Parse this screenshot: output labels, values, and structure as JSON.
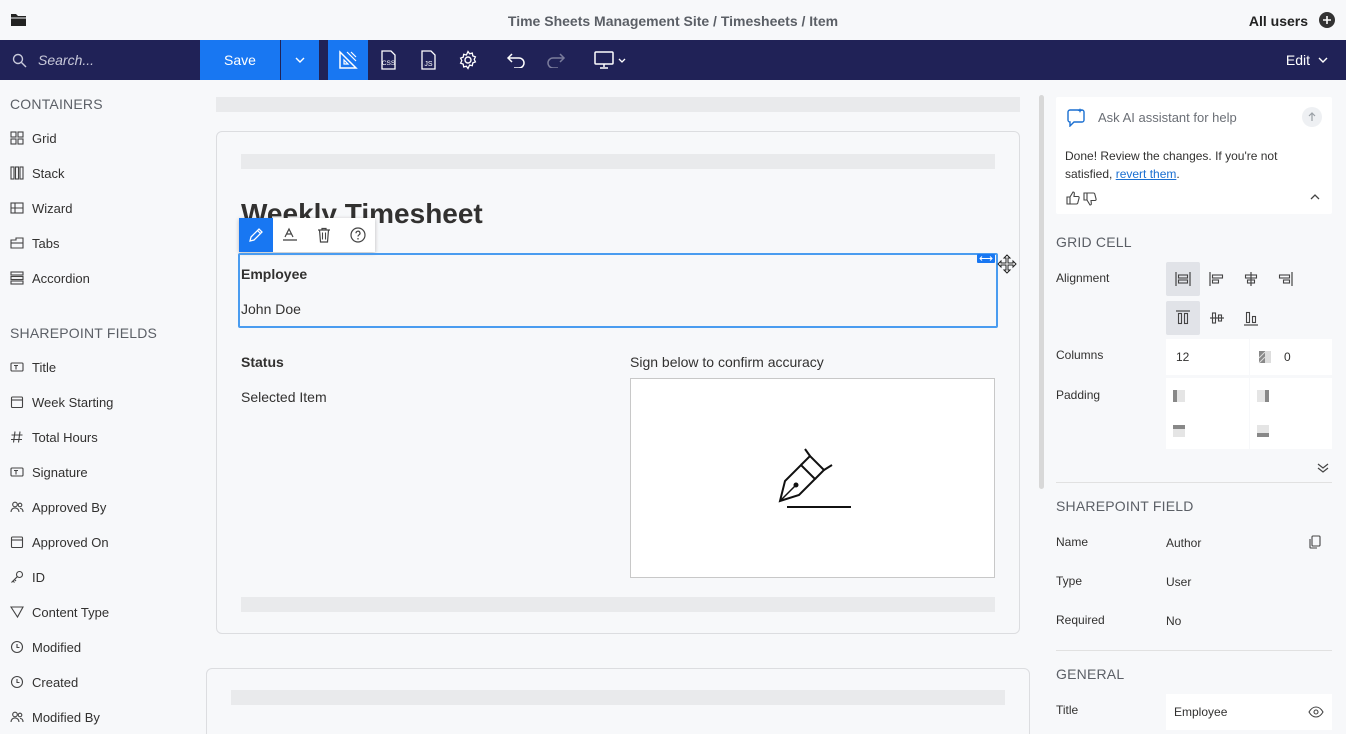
{
  "breadcrumb": "Time Sheets Management Site / Timesheets / Item",
  "users_label": "All users",
  "toolbar": {
    "search_placeholder": "Search...",
    "save_label": "Save",
    "css_label": "CSS",
    "js_label": "JS",
    "edit_label": "Edit"
  },
  "left": {
    "containers_title": "CONTAINERS",
    "containers": [
      {
        "label": "Grid",
        "icon": "grid-icon"
      },
      {
        "label": "Stack",
        "icon": "stack-icon"
      },
      {
        "label": "Wizard",
        "icon": "wizard-icon"
      },
      {
        "label": "Tabs",
        "icon": "tabs-icon"
      },
      {
        "label": "Accordion",
        "icon": "accordion-icon"
      }
    ],
    "fields_title": "SHAREPOINT FIELDS",
    "fields": [
      {
        "label": "Title",
        "icon": "text-field-icon"
      },
      {
        "label": "Week Starting",
        "icon": "calendar-icon"
      },
      {
        "label": "Total Hours",
        "icon": "number-icon"
      },
      {
        "label": "Signature",
        "icon": "text-field-icon"
      },
      {
        "label": "Approved By",
        "icon": "people-icon"
      },
      {
        "label": "Approved On",
        "icon": "calendar-icon"
      },
      {
        "label": "ID",
        "icon": "key-icon"
      },
      {
        "label": "Content Type",
        "icon": "filter-icon"
      },
      {
        "label": "Modified",
        "icon": "clock-icon"
      },
      {
        "label": "Created",
        "icon": "clock-icon"
      },
      {
        "label": "Modified By",
        "icon": "people-icon"
      }
    ]
  },
  "form": {
    "title": "Weekly Timesheet",
    "employee_label": "Employee",
    "employee_value": "John Doe",
    "status_label": "Status",
    "status_value": "Selected Item",
    "signature_label": "Sign below to confirm accuracy"
  },
  "ai": {
    "placeholder": "Ask AI assistant for help",
    "message": "Done! Review the changes. If you're not satisfied,",
    "link": "revert them",
    "message_end": "."
  },
  "grid_cell": {
    "title": "GRID CELL",
    "alignment_label": "Alignment",
    "columns_label": "Columns",
    "columns_value": "12",
    "offset_value": "0",
    "padding_label": "Padding"
  },
  "sp_field": {
    "title": "SHAREPOINT FIELD",
    "name_label": "Name",
    "name_value": "Author",
    "type_label": "Type",
    "type_value": "User",
    "required_label": "Required",
    "required_value": "No"
  },
  "general": {
    "title": "GENERAL",
    "title_label": "Title",
    "title_value": "Employee"
  },
  "colors": {
    "toolbar": "#202257",
    "accent": "#1877f2"
  }
}
